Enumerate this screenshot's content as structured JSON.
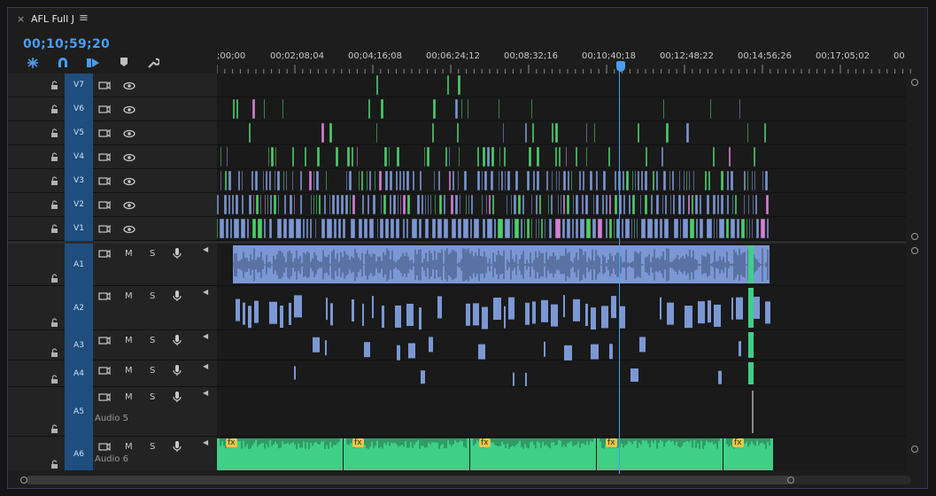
{
  "sequence": {
    "title": "AFL Full J",
    "close_glyph": "×",
    "menu_glyph": "≡",
    "timecode": "00;10;59;20"
  },
  "ruler": {
    "labels": [
      ";00;00",
      "00;02;08;04",
      "00;04;16;08",
      "00;06;24;12",
      "00;08;32;16",
      "00;10;40;18",
      "00;12;48;22",
      "00;14;56;26",
      "00;17;05;02",
      "00"
    ]
  },
  "video_tracks": [
    {
      "label": "V7"
    },
    {
      "label": "V6"
    },
    {
      "label": "V5"
    },
    {
      "label": "V4"
    },
    {
      "label": "V3"
    },
    {
      "label": "V2"
    },
    {
      "label": "V1"
    }
  ],
  "audio_tracks": [
    {
      "label": "A1",
      "name": ""
    },
    {
      "label": "A2",
      "name": ""
    },
    {
      "label": "A3",
      "name": ""
    },
    {
      "label": "A4",
      "name": ""
    },
    {
      "label": "A5",
      "name": "Audio 5"
    },
    {
      "label": "A6",
      "name": "Audio 6"
    }
  ],
  "audio_buttons": {
    "mute": "M",
    "solo": "S"
  },
  "fx_badge": "fx",
  "colors": {
    "accent": "#4a9df0",
    "video_clip": "#7b98d4",
    "green_clip": "#4ccf6a",
    "pink_clip": "#d480d4",
    "music_clip": "#3fcf86",
    "track_label_bg": "#1f4e7e"
  },
  "icons": {
    "snap": "magnet-icon",
    "linked": "linked-selection-icon",
    "markers": "add-marker-icon",
    "settings": "wrench-icon",
    "lock": "lock-icon",
    "eye": "eye-icon",
    "sync": "sync-lock-icon",
    "mic": "microphone-icon"
  }
}
